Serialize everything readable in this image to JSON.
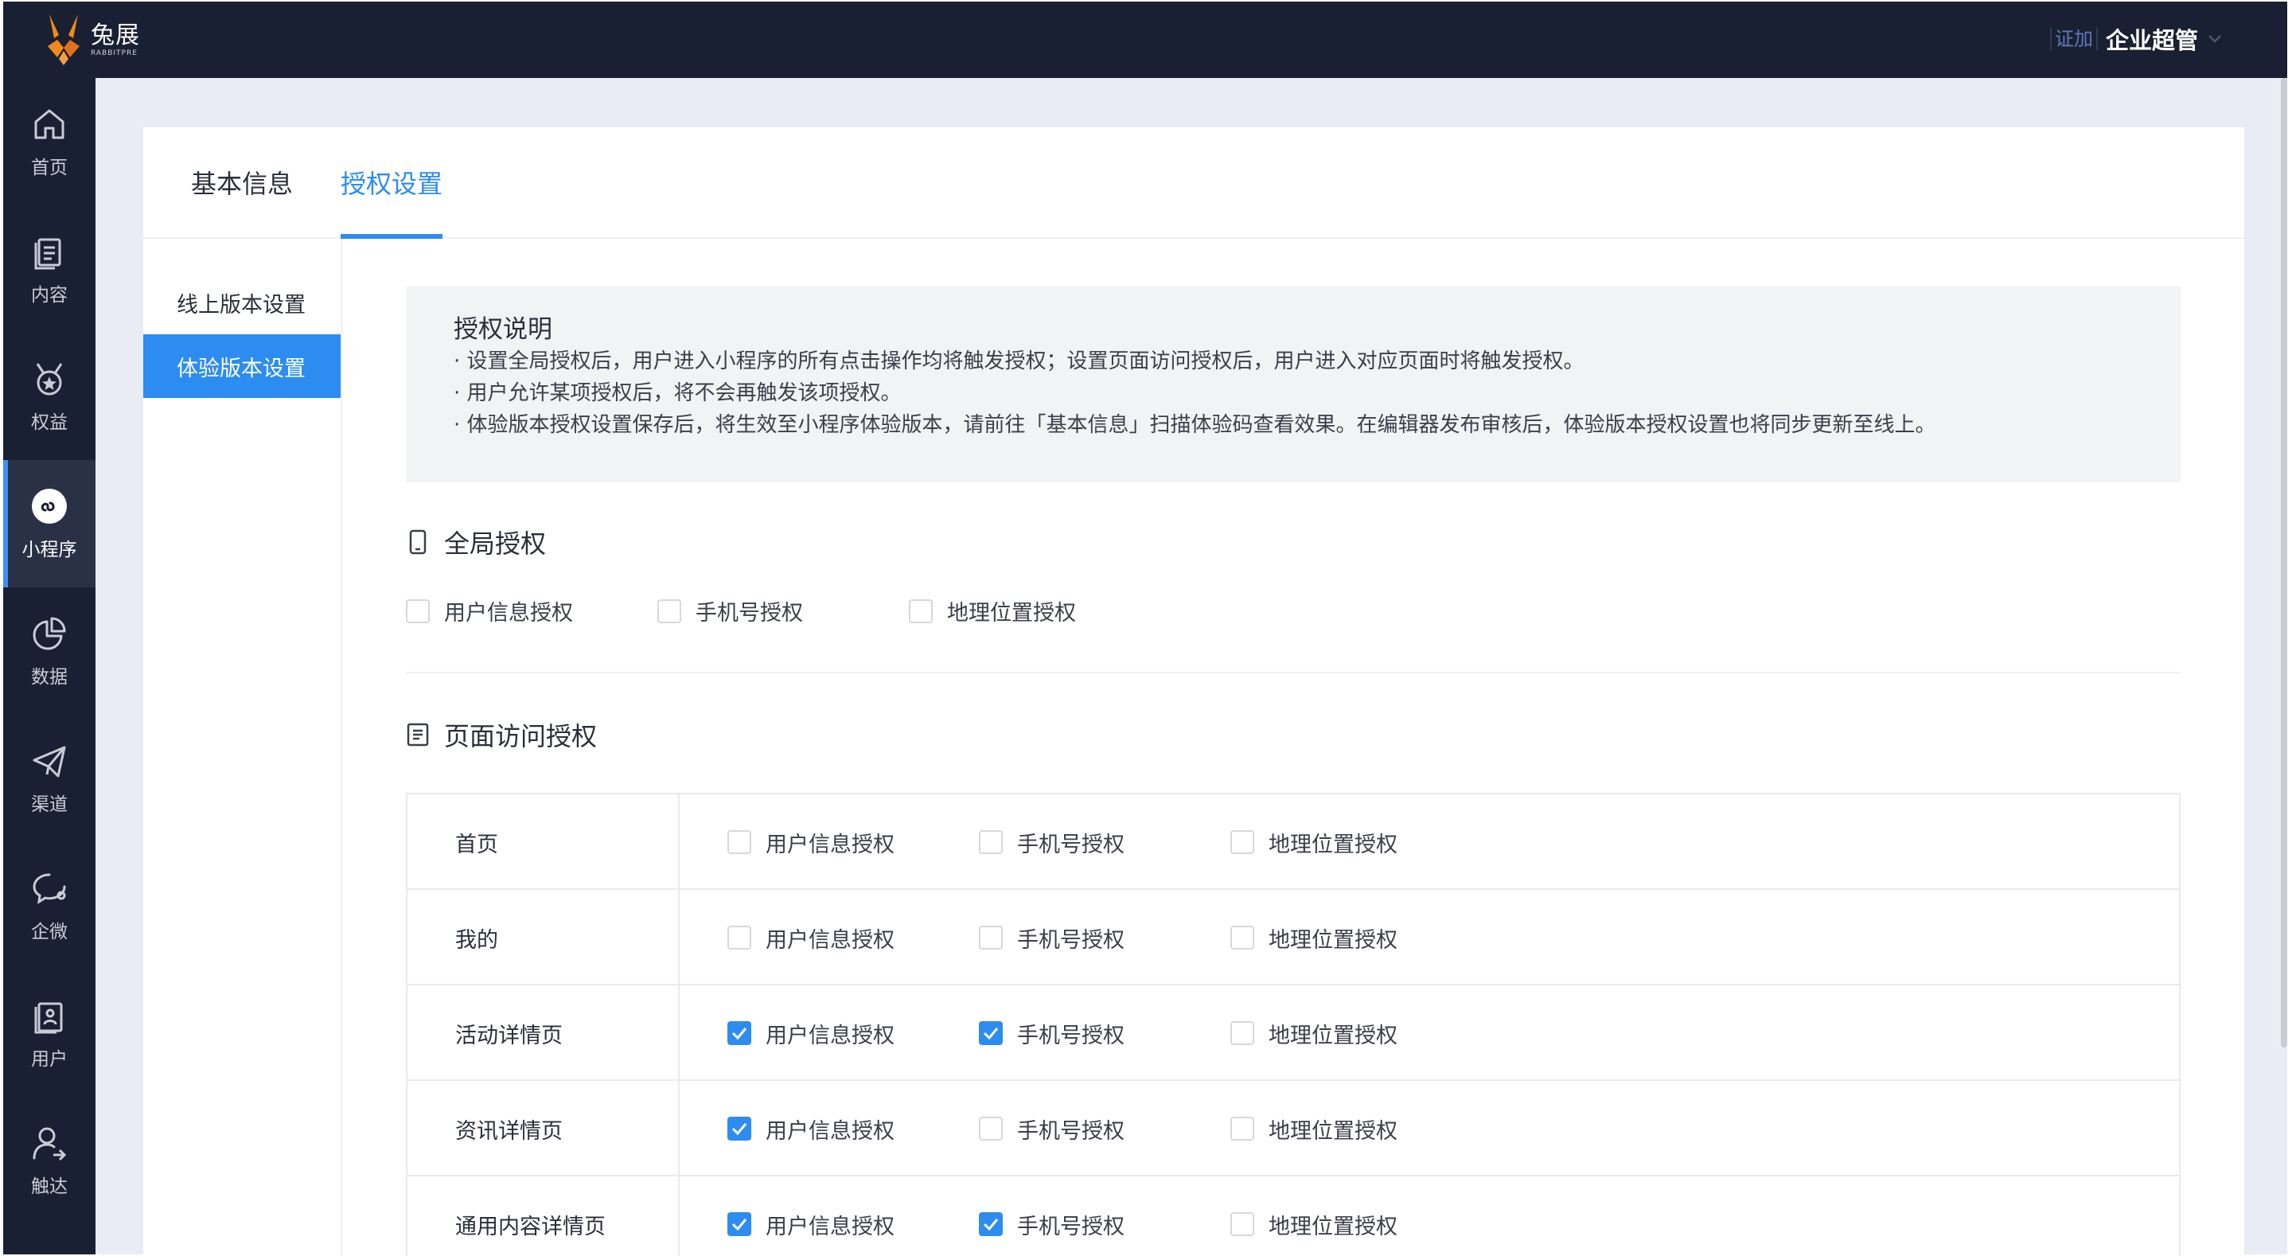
{
  "topbar": {
    "logo_text": "兔展",
    "logo_sub": "RABBITPRE",
    "cert_tag": "证加",
    "user_name": "企业超管"
  },
  "sidebar": {
    "items": [
      {
        "label": "首页",
        "icon": "home-icon"
      },
      {
        "label": "内容",
        "icon": "document-icon"
      },
      {
        "label": "权益",
        "icon": "medal-icon"
      },
      {
        "label": "小程序",
        "icon": "mini-program-icon",
        "active": true
      },
      {
        "label": "数据",
        "icon": "pie-chart-icon"
      },
      {
        "label": "渠道",
        "icon": "paper-plane-icon"
      },
      {
        "label": "企微",
        "icon": "chat-icon"
      },
      {
        "label": "用户",
        "icon": "user-list-icon"
      },
      {
        "label": "触达",
        "icon": "user-reach-icon"
      }
    ]
  },
  "tabs": {
    "basic": "基本信息",
    "auth": "授权设置"
  },
  "subnav": {
    "online": "线上版本设置",
    "trial": "体验版本设置"
  },
  "notice": {
    "title": "授权说明",
    "lines": [
      "· 设置全局授权后，用户进入小程序的所有点击操作均将触发授权；设置页面访问授权后，用户进入对应页面时将触发授权。",
      "· 用户允许某项授权后，将不会再触发该项授权。",
      "· 体验版本授权设置保存后，将生效至小程序体验版本，请前往「基本信息」扫描体验码查看效果。在编辑器发布审核后，体验版本授权设置也将同步更新至线上。"
    ]
  },
  "global": {
    "title": "全局授权",
    "options": [
      {
        "label": "用户信息授权",
        "checked": false
      },
      {
        "label": "手机号授权",
        "checked": false
      },
      {
        "label": "地理位置授权",
        "checked": false
      }
    ]
  },
  "page_auth": {
    "title": "页面访问授权",
    "rows": [
      {
        "name": "首页",
        "options": [
          {
            "label": "用户信息授权",
            "checked": false
          },
          {
            "label": "手机号授权",
            "checked": false
          },
          {
            "label": "地理位置授权",
            "checked": false
          }
        ]
      },
      {
        "name": "我的",
        "options": [
          {
            "label": "用户信息授权",
            "checked": false
          },
          {
            "label": "手机号授权",
            "checked": false
          },
          {
            "label": "地理位置授权",
            "checked": false
          }
        ]
      },
      {
        "name": "活动详情页",
        "options": [
          {
            "label": "用户信息授权",
            "checked": true
          },
          {
            "label": "手机号授权",
            "checked": true
          },
          {
            "label": "地理位置授权",
            "checked": false
          }
        ]
      },
      {
        "name": "资讯详情页",
        "options": [
          {
            "label": "用户信息授权",
            "checked": true
          },
          {
            "label": "手机号授权",
            "checked": false
          },
          {
            "label": "地理位置授权",
            "checked": false
          }
        ]
      },
      {
        "name": "通用内容详情页",
        "options": [
          {
            "label": "用户信息授权",
            "checked": true
          },
          {
            "label": "手机号授权",
            "checked": true
          },
          {
            "label": "地理位置授权",
            "checked": false
          }
        ]
      }
    ]
  }
}
